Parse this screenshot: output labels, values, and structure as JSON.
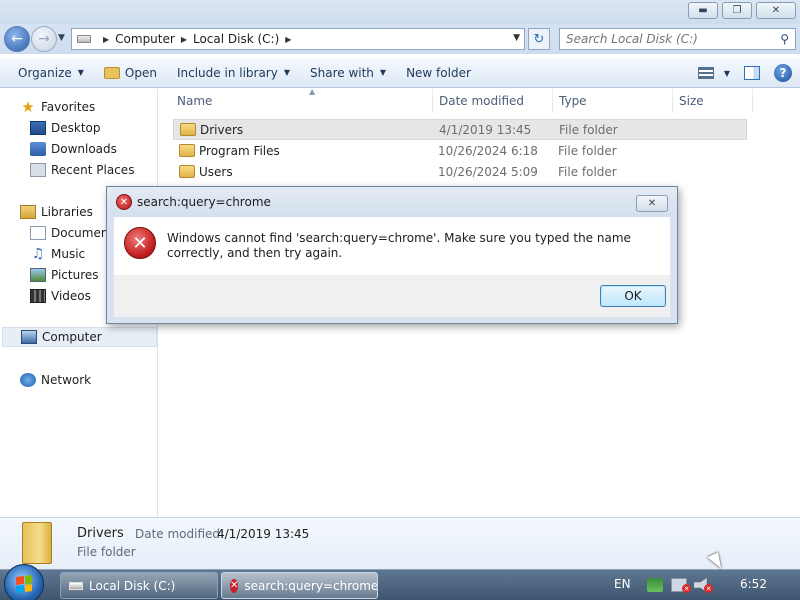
{
  "address": {
    "crumbs": [
      "Computer",
      "Local Disk (C:)"
    ],
    "search_placeholder": "Search Local Disk (C:)"
  },
  "toolbar": {
    "organize": "Organize",
    "open": "Open",
    "include": "Include in library",
    "share": "Share with",
    "new_folder": "New folder"
  },
  "nav": {
    "favorites": "Favorites",
    "desktop": "Desktop",
    "downloads": "Downloads",
    "recent": "Recent Places",
    "libraries": "Libraries",
    "documents": "Documents",
    "music": "Music",
    "pictures": "Pictures",
    "videos": "Videos",
    "computer": "Computer",
    "network": "Network"
  },
  "columns": [
    "Name",
    "Date modified",
    "Type",
    "Size"
  ],
  "files": [
    {
      "name": "Drivers",
      "date": "4/1/2019 13:45",
      "type": "File folder"
    },
    {
      "name": "Program Files",
      "date": "10/26/2024 6:18",
      "type": "File folder"
    },
    {
      "name": "Users",
      "date": "10/26/2024 5:09",
      "type": "File folder"
    }
  ],
  "details": {
    "name": "Drivers",
    "date_label": "Date modified:",
    "date": "4/1/2019 13:45",
    "type": "File folder"
  },
  "dialog": {
    "title": "search:query=chrome",
    "message": "Windows cannot find 'search:query=chrome'. Make sure you typed the name correctly, and then try again.",
    "ok": "OK"
  },
  "taskbar": {
    "items": [
      "Local Disk (C:)",
      "search:query=chrome"
    ],
    "lang": "EN",
    "time": "6:52"
  }
}
